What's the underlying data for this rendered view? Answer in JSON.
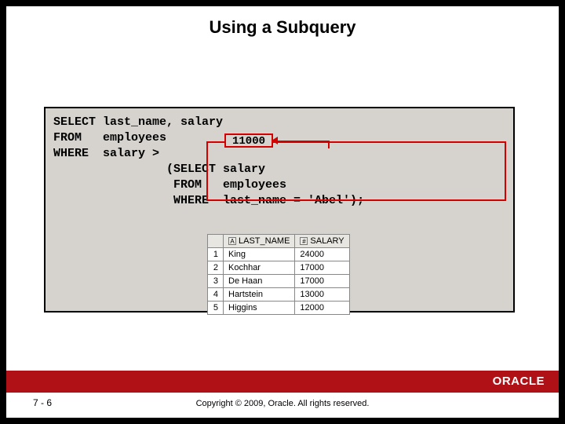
{
  "title": "Using a Subquery",
  "code": {
    "l1": "SELECT last_name, salary",
    "l2": "FROM   employees",
    "l3": "WHERE  salary >",
    "l4": "                (SELECT salary",
    "l5": "                 FROM   employees",
    "l6": "                 WHERE  last_name = 'Abel');",
    "subquery_value": "11000"
  },
  "result": {
    "col1": "LAST_NAME",
    "col2": "SALARY",
    "rows": [
      {
        "n": "1",
        "name": "King",
        "salary": "24000"
      },
      {
        "n": "2",
        "name": "Kochhar",
        "salary": "17000"
      },
      {
        "n": "3",
        "name": "De Haan",
        "salary": "17000"
      },
      {
        "n": "4",
        "name": "Hartstein",
        "salary": "13000"
      },
      {
        "n": "5",
        "name": "Higgins",
        "salary": "12000"
      }
    ]
  },
  "footer": {
    "page": "7 - 6",
    "copyright": "Copyright © 2009, Oracle. All rights reserved.",
    "logo": "ORACLE"
  }
}
